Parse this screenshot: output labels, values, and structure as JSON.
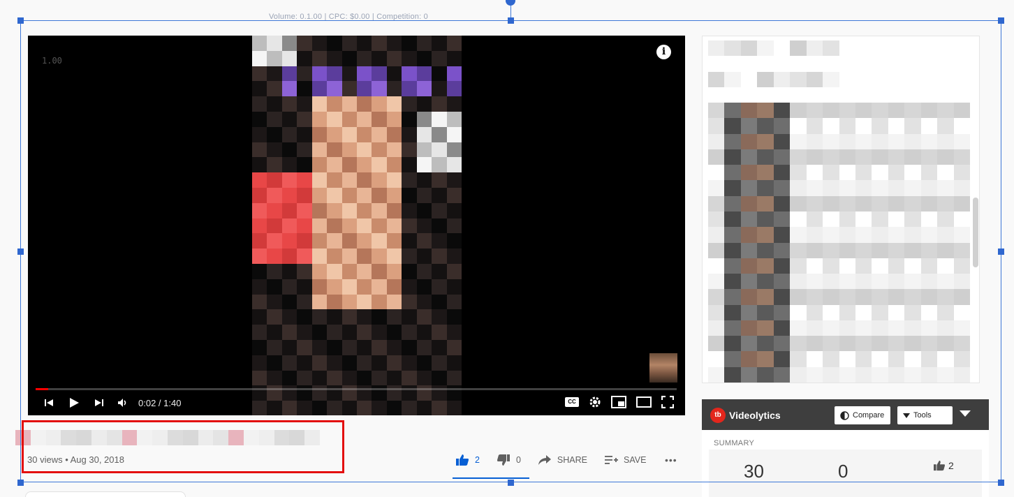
{
  "top_caption": "Volume: 0.1.00 | CPC: $0.00 | Competition: 0",
  "player": {
    "speed_readout": "1.00",
    "time_display": "0:02 / 1:40",
    "progress_fraction": 0.02,
    "icons": {
      "info": "info-icon",
      "prev": "skip-previous-icon",
      "play": "play-icon",
      "next": "skip-next-icon",
      "volume": "volume-icon",
      "cc": "CC",
      "settings": "gear-icon",
      "miniplayer": "miniplayer-icon",
      "theater": "theater-mode-icon",
      "fullscreen": "fullscreen-icon"
    }
  },
  "video": {
    "views_date": "30 views • Aug 30, 2018"
  },
  "actions": {
    "like_count": "2",
    "dislike_count": "0",
    "share_label": "SHARE",
    "save_label": "SAVE",
    "more": "•••"
  },
  "videolytics": {
    "brand": "Videolytics",
    "logo_text": "tb",
    "compare_label": "Compare",
    "tools_label": "Tools",
    "summary_label": "SUMMARY",
    "stat_views": "30",
    "stat_comments": "0",
    "stat_likes": "2"
  },
  "colors": {
    "accent_blue": "#065fd4",
    "progress_red": "#ff0000",
    "highlight_red": "#e30e0e",
    "selection_blue": "#3d78d8",
    "videolytics_header": "#3e3e3e",
    "videolytics_logo": "#e3261c"
  }
}
